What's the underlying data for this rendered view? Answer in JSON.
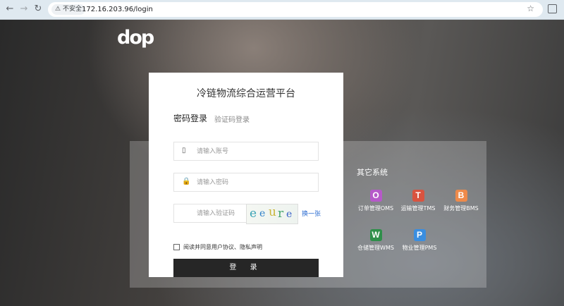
{
  "browser": {
    "back_icon": "arrow-left-icon",
    "forward_icon": "arrow-right-icon",
    "reload_icon": "reload-icon",
    "insecure_label": "不安全",
    "url": "172.16.203.96/login"
  },
  "logo": "dop",
  "login": {
    "title": "冷链物流综合运营平台",
    "tab_password": "密码登录",
    "tab_sms": "验证码登录",
    "account_placeholder": "请输入账号",
    "password_placeholder": "请输入密码",
    "captcha_placeholder": "请输入验证码",
    "captcha_text": [
      "e",
      "e",
      "u",
      "r",
      "e"
    ],
    "captcha_change": "换一张",
    "agree_text": "阅读并同意用户协议、隐私声明",
    "login_button": "登 录"
  },
  "systems": {
    "title": "其它系统",
    "items": [
      {
        "letter": "O",
        "label": "订单管理OMS",
        "color": "#b659c9"
      },
      {
        "letter": "T",
        "label": "运输管理TMS",
        "color": "#d9533f"
      },
      {
        "letter": "B",
        "label": "财务管理BMS",
        "color": "#ee8a4a"
      },
      {
        "letter": "W",
        "label": "仓储管理WMS",
        "color": "#2f8f4a"
      },
      {
        "letter": "P",
        "label": "物业管理PMS",
        "color": "#3a8ee0"
      }
    ]
  }
}
